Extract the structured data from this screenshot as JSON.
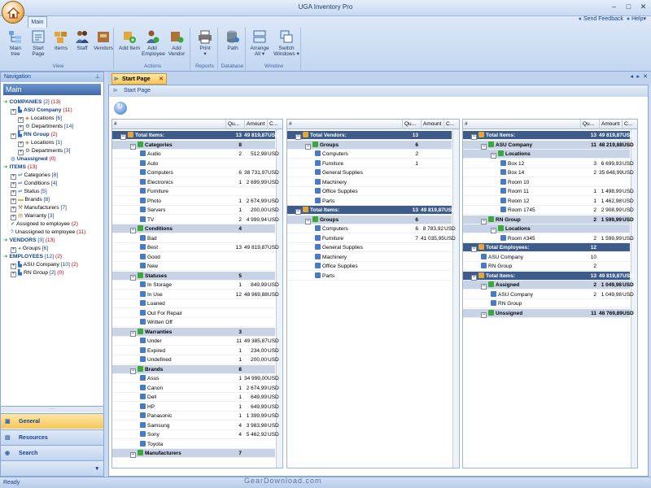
{
  "app": {
    "title": "UGA Inventory Pro",
    "send_feedback": "Send Feedback",
    "help": "Help"
  },
  "ribbon": {
    "tab": "Main",
    "groups": [
      {
        "label": "View",
        "buttons": [
          "Main tree",
          "Start Page",
          "Items",
          "Staff",
          "Vendors"
        ]
      },
      {
        "label": "Actions",
        "buttons": [
          "Add Item",
          "Add Employee",
          "Add Vendor"
        ]
      },
      {
        "label": "Reports",
        "buttons": [
          "Print"
        ]
      },
      {
        "label": "Database",
        "buttons": [
          "Path"
        ]
      },
      {
        "label": "Window",
        "buttons": [
          "Arrange All",
          "Switch Windows"
        ]
      }
    ]
  },
  "nav": {
    "header": "Navigation",
    "main_label": "Main",
    "tree": [
      {
        "label": "COMPANIES",
        "c1": "[2]",
        "c2": "(13)",
        "lvl": 0,
        "icon": "arrow",
        "bold": true
      },
      {
        "label": "ASU Company",
        "c1": "",
        "c2": "(11)",
        "lvl": 1,
        "icon": "company",
        "bold": true
      },
      {
        "label": "Locations",
        "c1": "[6]",
        "c2": "",
        "lvl": 2,
        "icon": "tag"
      },
      {
        "label": "Departments",
        "c1": "[14]",
        "c2": "",
        "lvl": 2,
        "icon": "gear"
      },
      {
        "label": "RN Group",
        "c1": "",
        "c2": "(2)",
        "lvl": 1,
        "icon": "company",
        "bold": true
      },
      {
        "label": "Locations",
        "c1": "[1]",
        "c2": "",
        "lvl": 2,
        "icon": "tag"
      },
      {
        "label": "Departments",
        "c1": "[3]",
        "c2": "",
        "lvl": 2,
        "icon": "gear"
      },
      {
        "label": "Unassigned",
        "c1": "",
        "c2": "(0)",
        "lvl": 1,
        "icon": "sphere",
        "bold": true
      },
      {
        "label": "ITEMS",
        "c1": "",
        "c2": "(13)",
        "lvl": 0,
        "icon": "arrow",
        "bold": true
      },
      {
        "label": "Categories",
        "c1": "[8]",
        "c2": "",
        "lvl": 1,
        "icon": "link"
      },
      {
        "label": "Conditions",
        "c1": "[4]",
        "c2": "",
        "lvl": 1,
        "icon": "link"
      },
      {
        "label": "Status",
        "c1": "[5]",
        "c2": "",
        "lvl": 1,
        "icon": "link"
      },
      {
        "label": "Brands",
        "c1": "[8]",
        "c2": "",
        "lvl": 1,
        "icon": "folder"
      },
      {
        "label": "Manufacturers",
        "c1": "[7]",
        "c2": "",
        "lvl": 1,
        "icon": "wrench"
      },
      {
        "label": "Warranty",
        "c1": "[3]",
        "c2": "",
        "lvl": 1,
        "icon": "doc"
      },
      {
        "label": "Assigned to employee",
        "c1": "",
        "c2": "(2)",
        "lvl": 1,
        "icon": "check"
      },
      {
        "label": "Unassigned to employee",
        "c1": "",
        "c2": "(11)",
        "lvl": 1,
        "icon": "question"
      },
      {
        "label": "VENDORS",
        "c1": "[3]",
        "c2": "(13)",
        "lvl": 0,
        "icon": "arrow",
        "bold": true
      },
      {
        "label": "Groups",
        "c1": "[6]",
        "c2": "",
        "lvl": 1,
        "icon": "group"
      },
      {
        "label": "EMPLOYEES",
        "c1": "[12]",
        "c2": "(2)",
        "lvl": 0,
        "icon": "arrow",
        "bold": true
      },
      {
        "label": "ASU Company",
        "c1": "[10]",
        "c2": "(2)",
        "lvl": 1,
        "icon": "company"
      },
      {
        "label": "RN Group",
        "c1": "[2]",
        "c2": "(0)",
        "lvl": 1,
        "icon": "company"
      }
    ],
    "buttons": [
      "General",
      "Resources",
      "Search"
    ]
  },
  "doc": {
    "tab": "Start Page",
    "title": "Start Page"
  },
  "columns": [
    "#",
    "Qu...",
    "Amount",
    "C..."
  ],
  "grid1": [
    {
      "t": "dark",
      "n": "Total Items:",
      "q": "13",
      "a": "49 819,87",
      "c": "USD",
      "i": 0
    },
    {
      "t": "grp",
      "n": "Categories",
      "q": "8",
      "a": "",
      "c": "",
      "i": 1
    },
    {
      "t": "r",
      "n": "Audio",
      "q": "2",
      "a": "512,98",
      "c": "USD",
      "i": 2
    },
    {
      "t": "r",
      "n": "Auto",
      "q": "",
      "a": "",
      "c": "",
      "i": 2
    },
    {
      "t": "r",
      "n": "Computers",
      "q": "6",
      "a": "38 731,97",
      "c": "USD",
      "i": 2
    },
    {
      "t": "r",
      "n": "Electronics",
      "q": "1",
      "a": "2 699,99",
      "c": "USD",
      "i": 2
    },
    {
      "t": "r",
      "n": "Furniture",
      "q": "",
      "a": "",
      "c": "",
      "i": 2
    },
    {
      "t": "r",
      "n": "Photo",
      "q": "1",
      "a": "2 674,99",
      "c": "USD",
      "i": 2
    },
    {
      "t": "r",
      "n": "Servers",
      "q": "1",
      "a": "200,00",
      "c": "USD",
      "i": 2
    },
    {
      "t": "r",
      "n": "TV",
      "q": "2",
      "a": "4 999,94",
      "c": "USD",
      "i": 2
    },
    {
      "t": "grp",
      "n": "Conditions",
      "q": "4",
      "a": "",
      "c": "",
      "i": 1
    },
    {
      "t": "r",
      "n": "Bad",
      "q": "",
      "a": "",
      "c": "",
      "i": 2
    },
    {
      "t": "r",
      "n": "Best",
      "q": "13",
      "a": "49 819,87",
      "c": "USD",
      "i": 2
    },
    {
      "t": "r",
      "n": "Good",
      "q": "",
      "a": "",
      "c": "",
      "i": 2
    },
    {
      "t": "r",
      "n": "New",
      "q": "",
      "a": "",
      "c": "",
      "i": 2
    },
    {
      "t": "grp",
      "n": "Statuses",
      "q": "5",
      "a": "",
      "c": "",
      "i": 1
    },
    {
      "t": "r",
      "n": "In Storage",
      "q": "1",
      "a": "849,99",
      "c": "USD",
      "i": 2
    },
    {
      "t": "r",
      "n": "In Use",
      "q": "12",
      "a": "48 969,88",
      "c": "USD",
      "i": 2
    },
    {
      "t": "r",
      "n": "Loaned",
      "q": "",
      "a": "",
      "c": "",
      "i": 2
    },
    {
      "t": "r",
      "n": "Out For Repair",
      "q": "",
      "a": "",
      "c": "",
      "i": 2
    },
    {
      "t": "r",
      "n": "Written Off",
      "q": "",
      "a": "",
      "c": "",
      "i": 2
    },
    {
      "t": "grp",
      "n": "Warranties",
      "q": "3",
      "a": "",
      "c": "",
      "i": 1
    },
    {
      "t": "r",
      "n": "Under",
      "q": "11",
      "a": "49 385,87",
      "c": "USD",
      "i": 2
    },
    {
      "t": "r",
      "n": "Expired",
      "q": "1",
      "a": "234,00",
      "c": "USD",
      "i": 2
    },
    {
      "t": "r",
      "n": "Undefined",
      "q": "1",
      "a": "200,00",
      "c": "USD",
      "i": 2
    },
    {
      "t": "grp",
      "n": "Brands",
      "q": "8",
      "a": "",
      "c": "",
      "i": 1
    },
    {
      "t": "r",
      "n": "Asus",
      "q": "1",
      "a": "34 999,00",
      "c": "USD",
      "i": 2
    },
    {
      "t": "r",
      "n": "Canon",
      "q": "1",
      "a": "2 674,99",
      "c": "USD",
      "i": 2
    },
    {
      "t": "r",
      "n": "Dell",
      "q": "1",
      "a": "649,99",
      "c": "USD",
      "i": 2
    },
    {
      "t": "r",
      "n": "HP",
      "q": "1",
      "a": "649,99",
      "c": "USD",
      "i": 2
    },
    {
      "t": "r",
      "n": "Panasonic",
      "q": "1",
      "a": "1 399,99",
      "c": "USD",
      "i": 2
    },
    {
      "t": "r",
      "n": "Samsung",
      "q": "4",
      "a": "3 983,98",
      "c": "USD",
      "i": 2
    },
    {
      "t": "r",
      "n": "Sony",
      "q": "4",
      "a": "5 462,92",
      "c": "USD",
      "i": 2
    },
    {
      "t": "r",
      "n": "Toyota",
      "q": "",
      "a": "",
      "c": "",
      "i": 2
    },
    {
      "t": "grp",
      "n": "Manufacturers",
      "q": "7",
      "a": "",
      "c": "",
      "i": 1
    }
  ],
  "grid2": [
    {
      "t": "dark",
      "n": "Total Vendors:",
      "q": "13",
      "a": "",
      "c": "",
      "i": 0
    },
    {
      "t": "grp",
      "n": "Groups",
      "q": "6",
      "a": "",
      "c": "",
      "i": 1
    },
    {
      "t": "r",
      "n": "Computers",
      "q": "2",
      "a": "",
      "c": "",
      "i": 2
    },
    {
      "t": "r",
      "n": "Furniture",
      "q": "1",
      "a": "",
      "c": "",
      "i": 2
    },
    {
      "t": "r",
      "n": "General Supplies",
      "q": "",
      "a": "",
      "c": "",
      "i": 2
    },
    {
      "t": "r",
      "n": "Machinery",
      "q": "",
      "a": "",
      "c": "",
      "i": 2
    },
    {
      "t": "r",
      "n": "Office Supplies",
      "q": "",
      "a": "",
      "c": "",
      "i": 2
    },
    {
      "t": "r",
      "n": "Parts",
      "q": "",
      "a": "",
      "c": "",
      "i": 2
    },
    {
      "t": "dark",
      "n": "Total Items:",
      "q": "13",
      "a": "49 819,87",
      "c": "USD",
      "i": 0
    },
    {
      "t": "grp",
      "n": "Groups",
      "q": "6",
      "a": "",
      "c": "",
      "i": 1
    },
    {
      "t": "r",
      "n": "Computers",
      "q": "6",
      "a": "8 783,92",
      "c": "USD",
      "i": 2
    },
    {
      "t": "r",
      "n": "Furniture",
      "q": "7",
      "a": "41 035,95",
      "c": "USD",
      "i": 2
    },
    {
      "t": "r",
      "n": "General Supplies",
      "q": "",
      "a": "",
      "c": "",
      "i": 2
    },
    {
      "t": "r",
      "n": "Machinery",
      "q": "",
      "a": "",
      "c": "",
      "i": 2
    },
    {
      "t": "r",
      "n": "Office Supplies",
      "q": "",
      "a": "",
      "c": "",
      "i": 2
    },
    {
      "t": "r",
      "n": "Parts",
      "q": "",
      "a": "",
      "c": "",
      "i": 2
    }
  ],
  "grid3": [
    {
      "t": "dark",
      "n": "Total Items:",
      "q": "13",
      "a": "49 819,87",
      "c": "USD",
      "i": 0
    },
    {
      "t": "grp",
      "n": "ASU Company",
      "q": "11",
      "a": "48 219,88",
      "c": "USD",
      "i": 1
    },
    {
      "t": "grp",
      "n": "Locations",
      "q": "",
      "a": "",
      "c": "",
      "i": 2
    },
    {
      "t": "r",
      "n": "Box 12",
      "q": "3",
      "a": "6 699,93",
      "c": "USD",
      "i": 3
    },
    {
      "t": "r",
      "n": "Box 14",
      "q": "2",
      "a": "35 648,99",
      "c": "USD",
      "i": 3
    },
    {
      "t": "r",
      "n": "Room 10",
      "q": "",
      "a": "",
      "c": "",
      "i": 3
    },
    {
      "t": "r",
      "n": "Room 11",
      "q": "1",
      "a": "1 498,99",
      "c": "USD",
      "i": 3
    },
    {
      "t": "r",
      "n": "Room 12",
      "q": "1",
      "a": "1 462,98",
      "c": "USD",
      "i": 3
    },
    {
      "t": "r",
      "n": "Room 1745",
      "q": "2",
      "a": "2 908,99",
      "c": "USD",
      "i": 3
    },
    {
      "t": "grp",
      "n": "RN Group",
      "q": "2",
      "a": "1 599,99",
      "c": "USD",
      "i": 1
    },
    {
      "t": "grp",
      "n": "Locations",
      "q": "",
      "a": "",
      "c": "",
      "i": 2
    },
    {
      "t": "r",
      "n": "Room #345",
      "q": "2",
      "a": "1 599,99",
      "c": "USD",
      "i": 3
    },
    {
      "t": "dark",
      "n": "Total Employees:",
      "q": "12",
      "a": "",
      "c": "",
      "i": 0
    },
    {
      "t": "r",
      "n": "ASU Company",
      "q": "10",
      "a": "",
      "c": "",
      "i": 1
    },
    {
      "t": "r",
      "n": "RN Group",
      "q": "2",
      "a": "",
      "c": "",
      "i": 1
    },
    {
      "t": "dark",
      "n": "Total Items:",
      "q": "13",
      "a": "49 819,87",
      "c": "USD",
      "i": 0
    },
    {
      "t": "grp",
      "n": "Assigned",
      "q": "2",
      "a": "1 049,98",
      "c": "USD",
      "i": 1
    },
    {
      "t": "r",
      "n": "ASU Company",
      "q": "2",
      "a": "1 049,98",
      "c": "USD",
      "i": 2
    },
    {
      "t": "r",
      "n": "RN Group",
      "q": "",
      "a": "",
      "c": "",
      "i": 2
    },
    {
      "t": "grp",
      "n": "Unssigned",
      "q": "11",
      "a": "48 769,89",
      "c": "USD",
      "i": 1
    }
  ],
  "status": "Ready",
  "watermark": "GearDownload.com"
}
